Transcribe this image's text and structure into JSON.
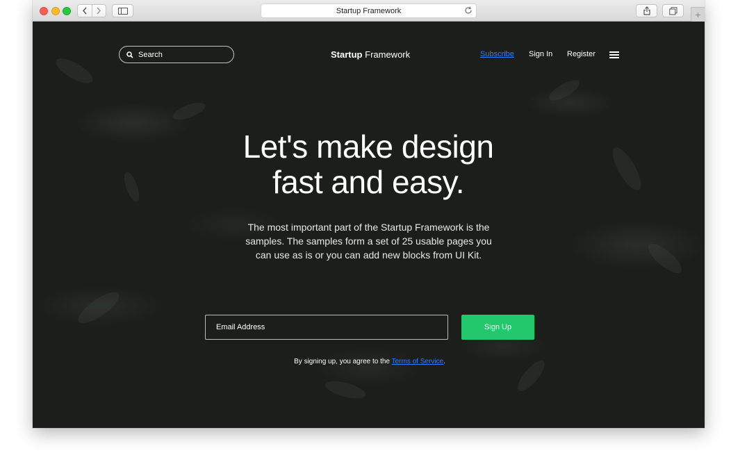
{
  "browser": {
    "tab_title": "Startup Framework",
    "new_tab": "+"
  },
  "header": {
    "search_placeholder": "Search",
    "brand_bold": "Startup",
    "brand_light": "Framework",
    "nav": {
      "subscribe": "Subscribe",
      "sign_in": "Sign In",
      "register": "Register"
    }
  },
  "hero": {
    "headline_line1": "Let's make design",
    "headline_line2": "fast and easy.",
    "description": "The most important part of the Startup Framework is the samples. The samples form a set of 25 usable pages you can use as is or you can add new blocks from UI Kit."
  },
  "signup_form": {
    "email_placeholder": "Email Address",
    "button_label": "Sign Up",
    "terms_prefix": "By signing up, you agree to the",
    "terms_link": "Terms of Service",
    "terms_suffix": "."
  },
  "colors": {
    "accent_green": "#22c86b",
    "link_blue": "#2e7dff",
    "background": "#1c1e1c"
  },
  "icons": [
    "search-icon",
    "menu-icon",
    "back-icon",
    "forward-icon",
    "sidebar-icon",
    "reload-icon",
    "share-icon",
    "tabs-icon"
  ]
}
